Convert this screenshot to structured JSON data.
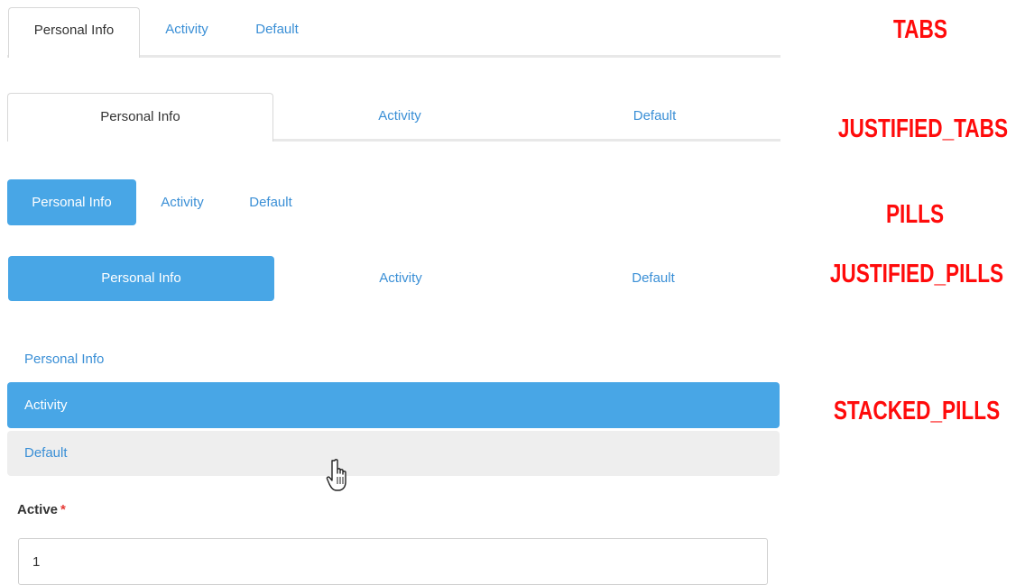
{
  "tabs": {
    "items": [
      {
        "label": "Personal Info",
        "active": true
      },
      {
        "label": "Activity",
        "active": false
      },
      {
        "label": "Default",
        "active": false
      }
    ]
  },
  "justified_tabs": {
    "items": [
      {
        "label": "Personal Info",
        "active": true
      },
      {
        "label": "Activity",
        "active": false
      },
      {
        "label": "Default",
        "active": false
      }
    ]
  },
  "pills": {
    "items": [
      {
        "label": "Personal Info",
        "active": true
      },
      {
        "label": "Activity",
        "active": false
      },
      {
        "label": "Default",
        "active": false
      }
    ]
  },
  "justified_pills": {
    "items": [
      {
        "label": "Personal Info",
        "active": true
      },
      {
        "label": "Activity",
        "active": false
      },
      {
        "label": "Default",
        "active": false
      }
    ]
  },
  "stacked_pills": {
    "items": [
      {
        "label": "Personal Info",
        "state": "default"
      },
      {
        "label": "Activity",
        "state": "active"
      },
      {
        "label": "Default",
        "state": "hover"
      }
    ]
  },
  "form": {
    "active_label": "Active",
    "required_marker": "*",
    "active_value": "1"
  },
  "annotations": {
    "tabs": "TABS",
    "justified_tabs": "JUSTIFIED_TABS",
    "pills": "PILLS",
    "justified_pills": "JUSTIFIED_PILLS",
    "stacked_pills": "STACKED_PILLS"
  },
  "cursor": {
    "icon": "hand-pointer-icon"
  },
  "colors": {
    "active_fill": "#48a6e6",
    "link": "#3a8fd6",
    "hover_fill": "#eeeeee",
    "annotation": "#ff0b0b",
    "required": "#e53935"
  }
}
